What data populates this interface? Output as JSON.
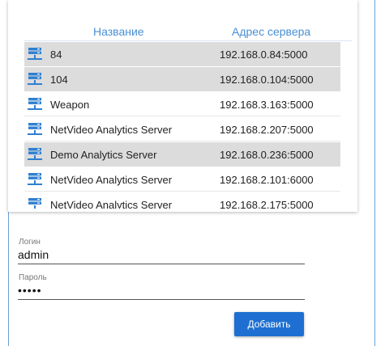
{
  "list": {
    "columns": {
      "name": "Название",
      "address": "Адрес сервера"
    },
    "rows": [
      {
        "name": "84",
        "address": "192.168.0.84:5000",
        "selected": true
      },
      {
        "name": "104",
        "address": "192.168.0.104:5000",
        "selected": true
      },
      {
        "name": "Weapon",
        "address": "192.168.3.163:5000",
        "selected": false
      },
      {
        "name": "NetVideo Analytics Server",
        "address": "192.168.2.207:5000",
        "selected": false
      },
      {
        "name": "Demo Analytics Server",
        "address": "192.168.0.236:5000",
        "selected": true
      },
      {
        "name": "NetVideo Analytics Server",
        "address": "192.168.2.101:6000",
        "selected": false
      },
      {
        "name": "NetVideo Analytics Server",
        "address": "192.168.2.175:5000",
        "selected": false
      }
    ],
    "icon": "server-icon"
  },
  "form": {
    "login_label": "Логин",
    "login_value": "admin",
    "password_label": "Пароль",
    "password_value": "•••••",
    "add_label": "Добавить"
  },
  "colors": {
    "accent": "#1e6fd1",
    "header_text": "#4a8fd4",
    "selected_row": "#dcdcdc",
    "icon": "#2f7fd0"
  }
}
